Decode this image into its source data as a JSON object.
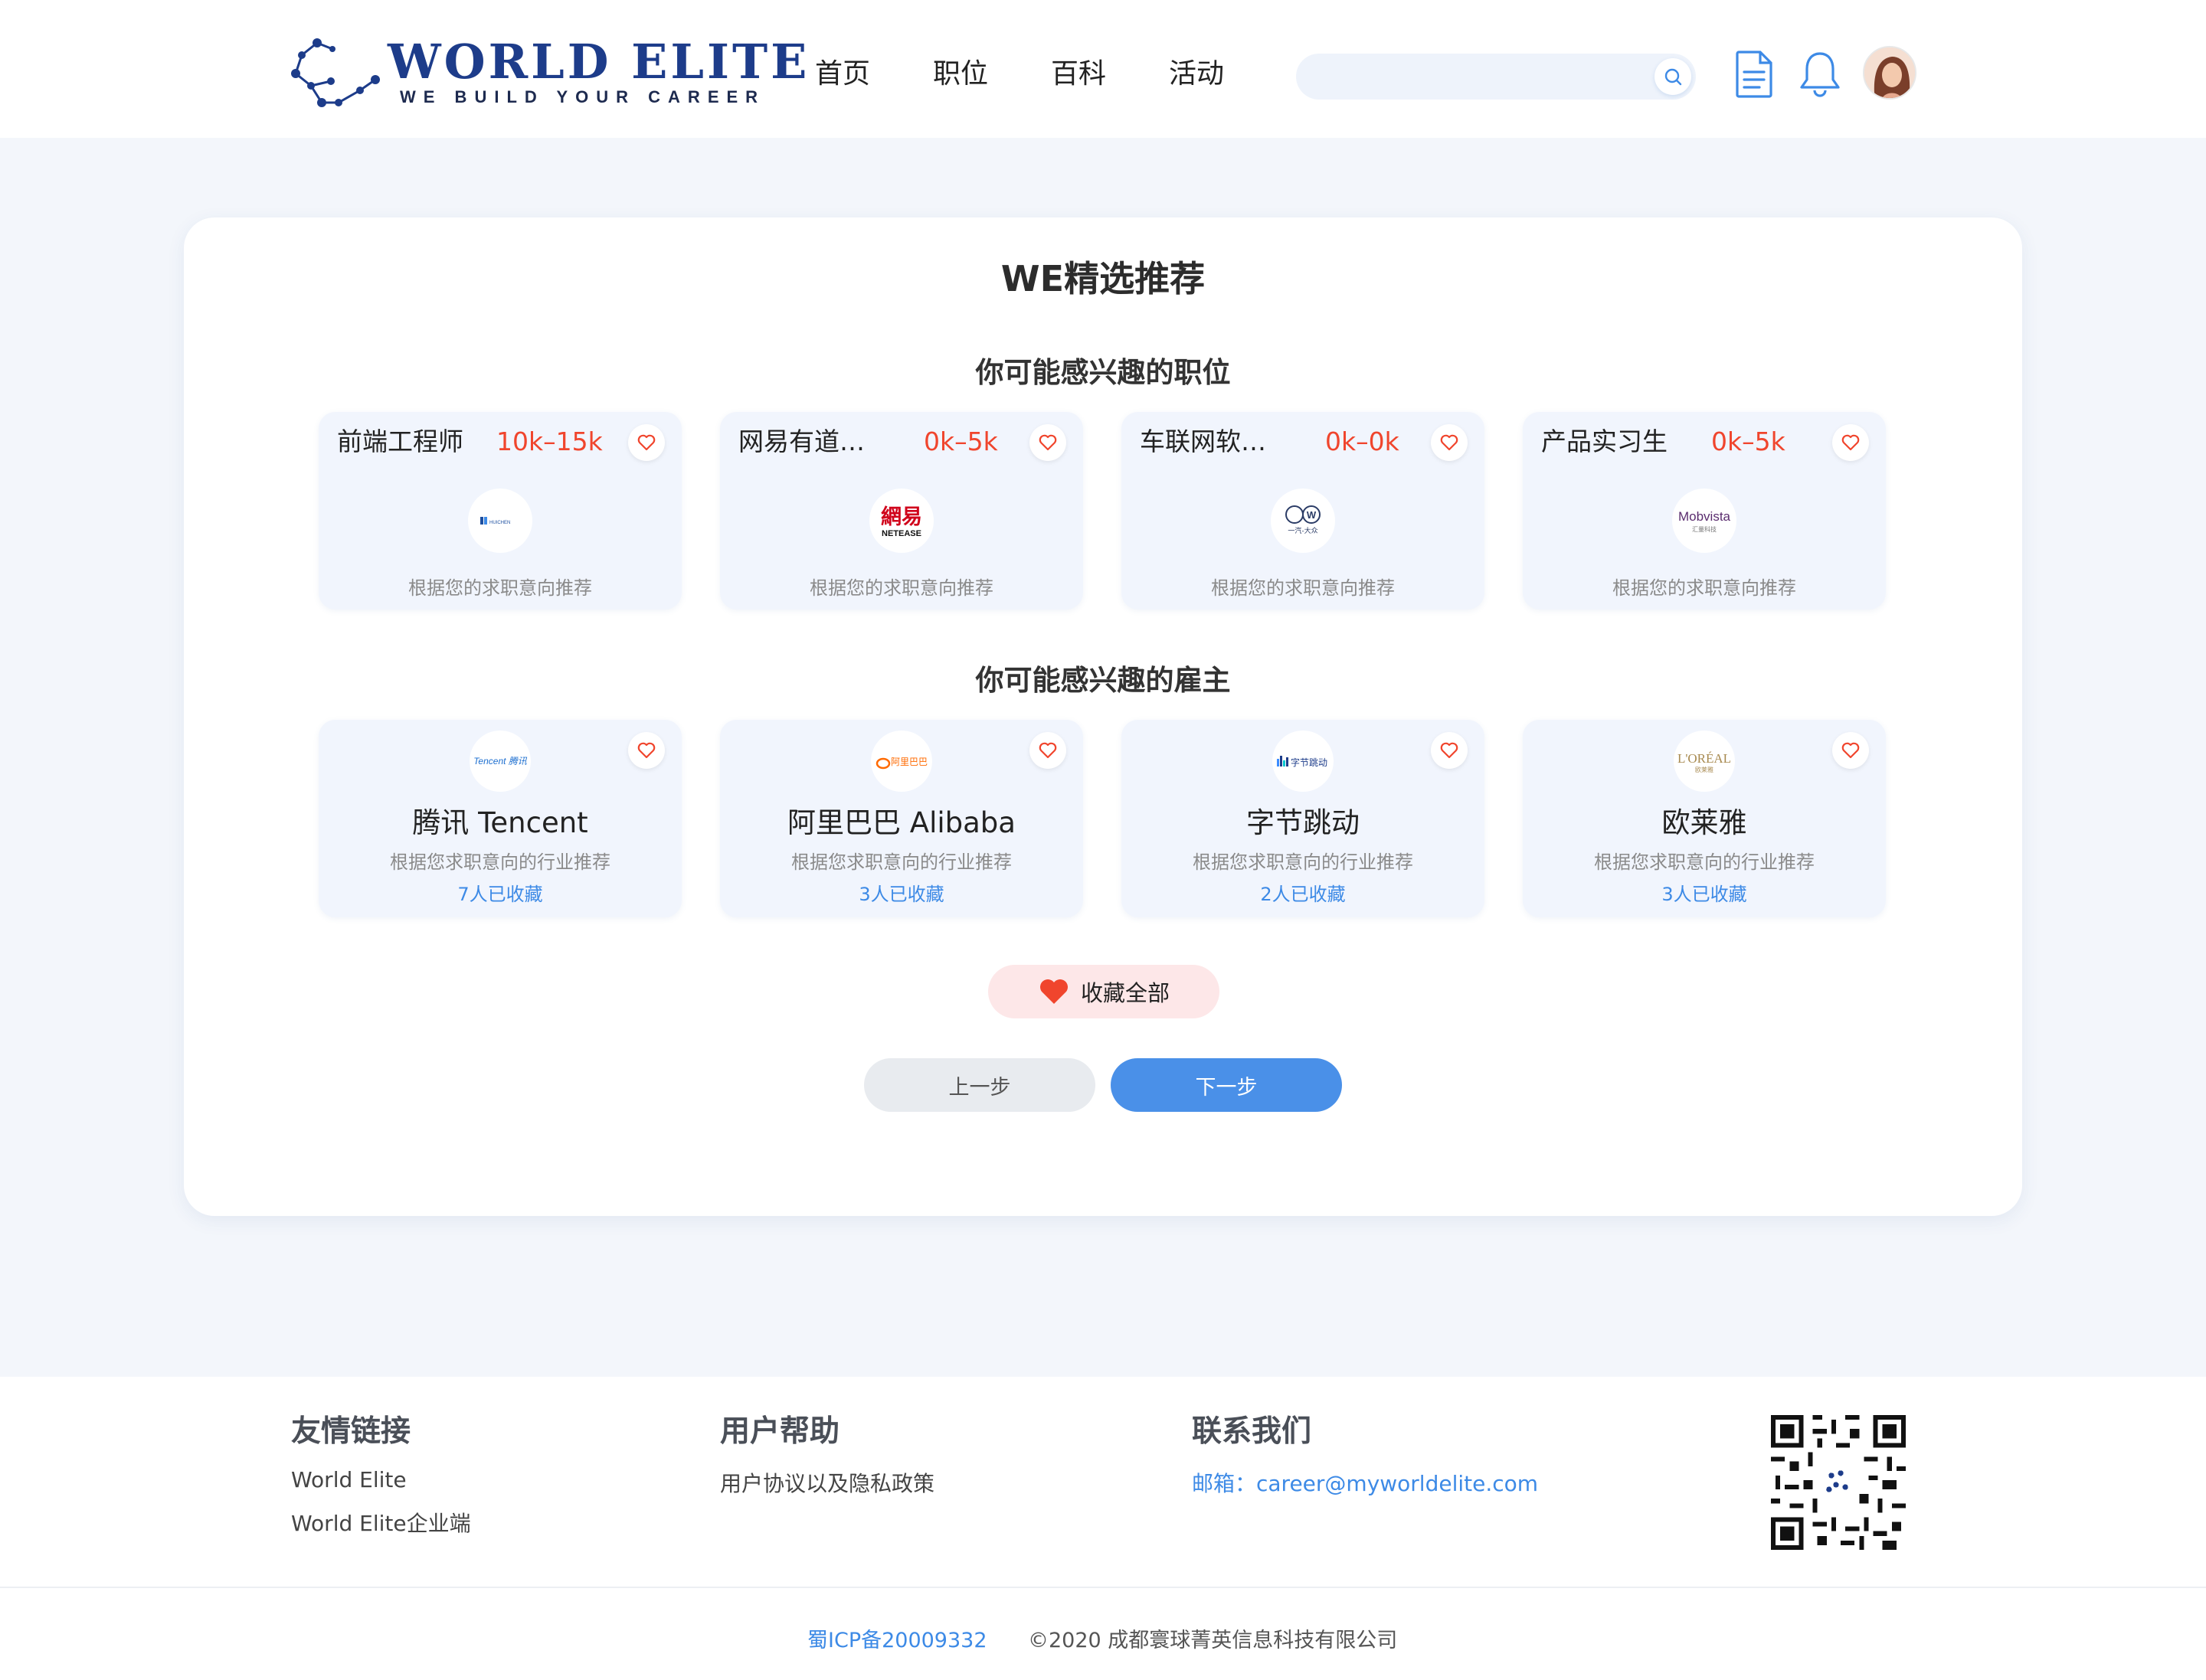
{
  "brand": {
    "title": "WORLD ELITE",
    "tagline": "WE BUILD YOUR CAREER",
    "primary_color": "#1d3c8a",
    "accent_color": "#4a90e8",
    "danger_color": "#f0452d"
  },
  "nav": [
    "首页",
    "职位",
    "百科",
    "活动"
  ],
  "search": {
    "placeholder": "",
    "icon": "search-icon"
  },
  "header_icons": [
    "resume-document-icon",
    "bell-icon",
    "user-avatar"
  ],
  "card": {
    "title": "WE精选推荐",
    "jobs_section_title": "你可能感兴趣的职位",
    "employers_section_title": "你可能感兴趣的雇主",
    "jobs": [
      {
        "title": "前端工程师",
        "salary": "10k–15k",
        "logo_text": "HUICHEN",
        "note": "根据您的求职意向推荐"
      },
      {
        "title": "网易有道图…",
        "salary": "0k–5k",
        "logo_text": "網易",
        "logo_sub": "NETEASE",
        "note": "根据您的求职意向推荐"
      },
      {
        "title": "车联网软件…",
        "salary": "0k–0k",
        "logo_text": "一汽-大众",
        "note": "根据您的求职意向推荐"
      },
      {
        "title": "产品实习生",
        "salary": "0k–5k",
        "logo_text": "Mobvista",
        "logo_sub": "汇量科技",
        "note": "根据您的求职意向推荐"
      }
    ],
    "employers": [
      {
        "name": "腾讯 Tencent",
        "logo_text": "Tencent 腾讯",
        "note": "根据您求职意向的行业推荐",
        "favorites": "7人已收藏"
      },
      {
        "name": "阿里巴巴 Alibaba",
        "logo_text": "阿里巴巴",
        "note": "根据您求职意向的行业推荐",
        "favorites": "3人已收藏"
      },
      {
        "name": "字节跳动",
        "logo_text": "字节跳动",
        "note": "根据您求职意向的行业推荐",
        "favorites": "2人已收藏"
      },
      {
        "name": "欧莱雅",
        "logo_text": "L'ORÉAL",
        "logo_sub": "欧莱雅",
        "note": "根据您求职意向的行业推荐",
        "favorites": "3人已收藏"
      }
    ],
    "collect_all_label": "收藏全部",
    "prev_label": "上一步",
    "next_label": "下一步"
  },
  "footer": {
    "links_title": "友情链接",
    "links": [
      "World Elite",
      "World Elite企业端"
    ],
    "help_title": "用户帮助",
    "help_links": [
      "用户协议以及隐私政策"
    ],
    "contact_title": "联系我们",
    "email": "邮箱：career@myworldelite.com",
    "icp": "蜀ICP备20009332",
    "copyright": "©2020 成都寰球菁英信息科技有限公司"
  }
}
